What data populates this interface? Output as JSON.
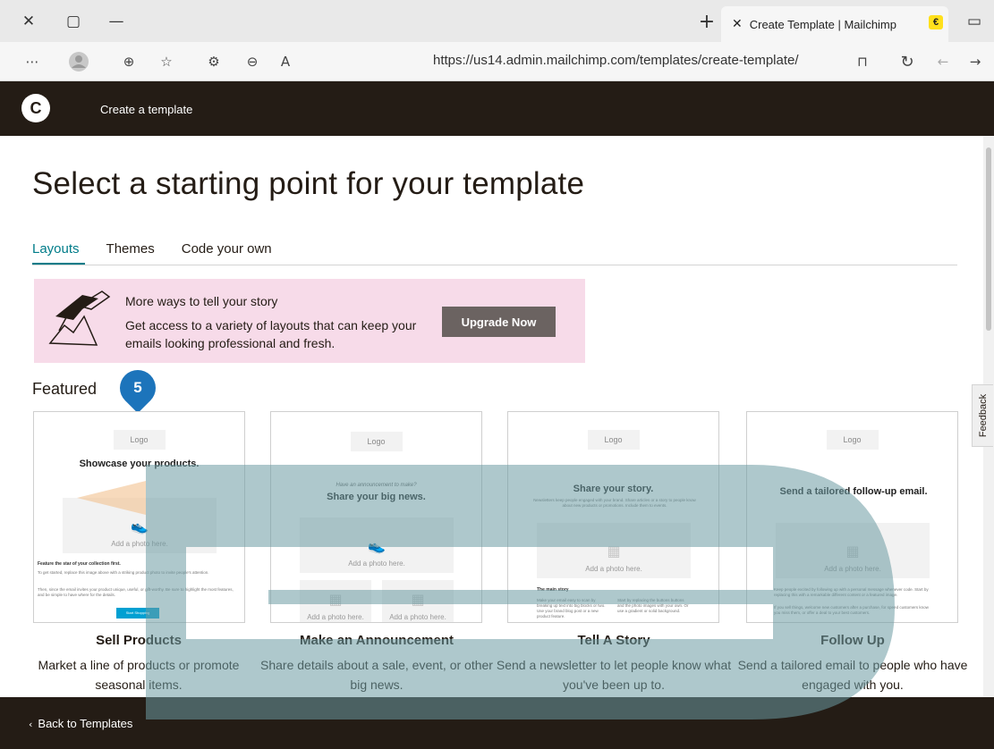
{
  "browser": {
    "tab_title": "Create Template | Mailchimp",
    "url": "https://us14.admin.mailchimp.com/templates/create-template/",
    "tab_favicon": "mailchimp-icon",
    "icons": [
      "close-icon",
      "restore-icon",
      "minimize-icon",
      "new-tab-icon",
      "more-icon",
      "profile-icon",
      "collections-icon",
      "favorites-icon",
      "extensions-icon",
      "zoom-icon",
      "read-aloud-icon",
      "lock-icon",
      "refresh-icon",
      "back-icon",
      "forward-icon"
    ]
  },
  "app": {
    "title": "Create a template"
  },
  "page": {
    "heading": "Select a starting point for your template",
    "tabs": [
      {
        "label": "Layouts"
      },
      {
        "label": "Themes"
      },
      {
        "label": "Code your own"
      }
    ],
    "promo": {
      "title": "More ways to tell your story",
      "body": "Get access to a variety of layouts that can keep your emails looking professional and fresh.",
      "button": "Upgrade Now"
    },
    "featured_label": "Featured",
    "step_badge": "5",
    "cards": [
      {
        "title": "Sell Products",
        "desc": "Market a line of products or promote seasonal items.",
        "preview": {
          "logo": "Logo",
          "headline": "Showcase your products.",
          "photo": "Add a photo here.",
          "subhead": "Feature the star of your collection first.",
          "body1": "To get started, replace this image above with a striking product photo to invite people's attention.",
          "body2": "Then, since the email invites your product unique, useful, or gift-worthy. Be sure to highlight the most features, and be simple to have where for the details.",
          "button": "Start Shopping"
        }
      },
      {
        "title": "Make an Announcement",
        "desc": "Share details about a sale, event, or other big news.",
        "preview": {
          "logo": "Logo",
          "kicker": "Have an announcement to make?",
          "headline": "Share your big news.",
          "photo": "Add a photo here.",
          "photo2": "Add a photo here.",
          "photo3": "Add a photo here."
        }
      },
      {
        "title": "Tell A Story",
        "desc": "Send a newsletter to let people know what you've been up to.",
        "preview": {
          "logo": "Logo",
          "headline": "Share your story.",
          "intro": "Newsletters keep people engaged with your brand. Share articles or a story to people know about new products or promotions. Include them to events.",
          "photo": "Add a photo here.",
          "subhead": "The main story",
          "col1": "Make your email easy to scan by breaking up text into big blocks or two. Use your brand blog post or a new product feature.",
          "col2": "Start by replacing the buttons buttons and the photo images with your own. Or use a gradient or solid background."
        }
      },
      {
        "title": "Follow Up",
        "desc": "Send a tailored email to people who have engaged with you.",
        "preview": {
          "logo": "Logo",
          "headline": "Send a tailored follow-up email.",
          "photo": "Add a photo here.",
          "body1": "Keep people excited by following up with a personal message whenever code. Start by replacing this with a remarkable different content or a featured image.",
          "body2": "If you sell things, welcome new customers after a purchase, for speed customers know you miss them, or offer a deal to your best customers."
        }
      }
    ],
    "feedback": "Feedback",
    "back_link": "Back to Templates"
  },
  "colors": {
    "accent": "#007c89",
    "dark": "#241c15",
    "promo_bg": "#f7dbe9",
    "badge": "#1c74bb",
    "overlay": "#6b9aa3"
  }
}
